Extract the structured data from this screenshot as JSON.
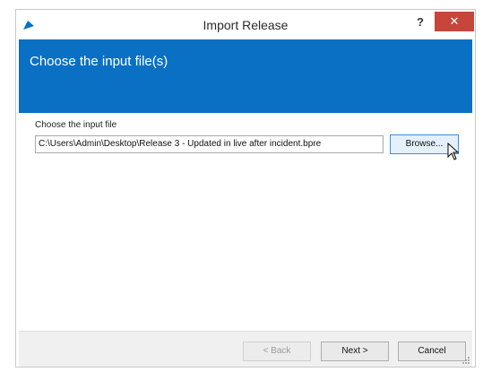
{
  "window": {
    "title": "Import Release",
    "help_label": "?",
    "close_label": "✕"
  },
  "banner": {
    "title": "Choose the input file(s)",
    "color": "#0a70c4"
  },
  "form": {
    "label": "Choose the input file",
    "file_path": "C:\\Users\\Admin\\Desktop\\Release 3 - Updated in live after incident.bpre",
    "browse_label": "Browse..."
  },
  "footer": {
    "back_label": "< Back",
    "next_label": "Next >",
    "cancel_label": "Cancel"
  },
  "icons": {
    "app": "app-logo-icon",
    "cursor": "mouse-pointer-icon",
    "grip": "resize-grip-icon"
  }
}
